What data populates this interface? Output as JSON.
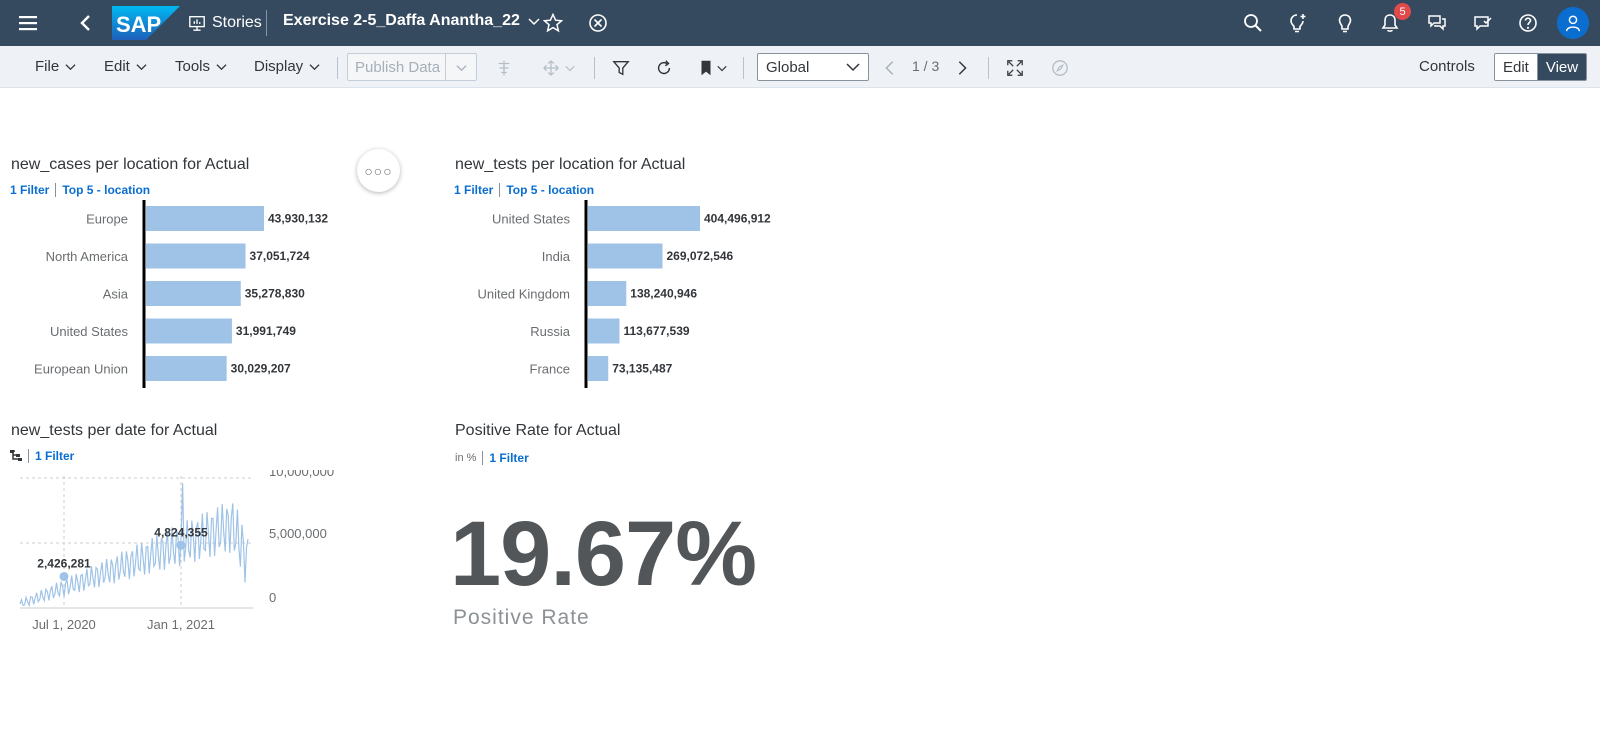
{
  "shell": {
    "stories_label": "Stories",
    "story_title": "Exercise 2-5_Daffa Anantha_22",
    "notification_count": "5",
    "logo_text": "SAP"
  },
  "toolbar": {
    "file": "File",
    "edit": "Edit",
    "tools": "Tools",
    "display": "Display",
    "publish_data": "Publish Data",
    "global_select": "Global",
    "pager": "1 / 3",
    "controls": "Controls",
    "mode_edit": "Edit",
    "mode_view": "View"
  },
  "widgets": {
    "cases": {
      "title": "new_cases per location for Actual",
      "filter": "1 Filter",
      "top": "Top 5 - location"
    },
    "tests": {
      "title": "new_tests per location for Actual",
      "filter": "1 Filter",
      "top": "Top 5 - location"
    },
    "tests_date": {
      "title": "new_tests per date for Actual",
      "filter": "1 Filter"
    },
    "positive": {
      "title": "Positive Rate for Actual",
      "unit": "in %",
      "filter": "1 Filter",
      "value": "19.67%",
      "label": "Positive Rate"
    }
  },
  "chart_data": [
    {
      "type": "bar",
      "orientation": "horizontal",
      "title": "new_cases per location for Actual",
      "categories": [
        "Europe",
        "North America",
        "Asia",
        "United States",
        "European Union"
      ],
      "values": [
        43930132,
        37051724,
        35278830,
        31991749,
        30029207
      ],
      "value_labels": [
        "43,930,132",
        "37,051,724",
        "35,278,830",
        "31,991,749",
        "30,029,207"
      ],
      "color": "#9fc3e7"
    },
    {
      "type": "bar",
      "orientation": "horizontal",
      "title": "new_tests per location for Actual",
      "categories": [
        "United States",
        "India",
        "United Kingdom",
        "Russia",
        "France"
      ],
      "values": [
        404496912,
        269072546,
        138240946,
        113677539,
        73135487
      ],
      "value_labels": [
        "404,496,912",
        "269,072,546",
        "138,240,946",
        "113,677,539",
        "73,135,487"
      ],
      "color": "#9fc3e7"
    },
    {
      "type": "line",
      "title": "new_tests per date for Actual",
      "ylim": [
        0,
        10000000
      ],
      "y_ticks": [
        "10,000,000",
        "5,000,000",
        "0"
      ],
      "x_ticks": [
        "Jul 1, 2020",
        "Jan 1, 2021"
      ],
      "annotations": [
        {
          "label": "2,426,281",
          "date": "Jul 1, 2020",
          "value": 2426281
        },
        {
          "label": "4,824,355",
          "date": "Jan 1, 2021",
          "value": 4824355
        }
      ],
      "color": "#9fc3e7"
    }
  ]
}
